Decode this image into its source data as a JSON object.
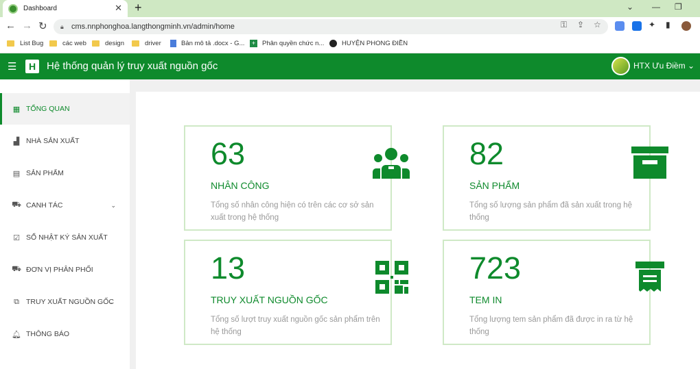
{
  "browser": {
    "tab_title": "Dashboard",
    "tab_close": "✕",
    "new_tab": "+",
    "url": "cms.nnphonghoa.langthongminh.vn/admin/home"
  },
  "bookmarks": [
    {
      "label": "List Bug",
      "icon": "folder-icon"
    },
    {
      "label": "các web",
      "icon": "folder-icon"
    },
    {
      "label": "design",
      "icon": "folder-icon"
    },
    {
      "label": "driver",
      "icon": "folder-icon"
    },
    {
      "label": "Bản mô tả .docx - G...",
      "icon": "doc-icon"
    },
    {
      "label": "Phân quyền chức n...",
      "icon": "sheet-icon"
    },
    {
      "label": "HUYỆN PHONG ĐIỀN",
      "icon": "globe-icon"
    }
  ],
  "header": {
    "logo": "H",
    "title": "Hệ thống quản lý truy xuất nguồn gốc",
    "user": "HTX Ưu Điềm"
  },
  "sidebar": {
    "items": [
      {
        "label": "TỔNG QUAN",
        "icon": "dashboard-icon",
        "active": true
      },
      {
        "label": "NHÀ SẢN XUẤT",
        "icon": "factory-icon"
      },
      {
        "label": "SẢN PHẨM",
        "icon": "store-icon"
      },
      {
        "label": "CANH TÁC",
        "icon": "tractor-icon",
        "has_submenu": true
      },
      {
        "label": "SỔ NHẬT KÝ SẢN XUẤT",
        "icon": "clipboard-icon"
      },
      {
        "label": "ĐƠN VỊ PHÂN PHỐI",
        "icon": "truck-icon"
      },
      {
        "label": "TRUY XUẤT NGUỒN GỐC",
        "icon": "route-icon",
        "has_submenu": true
      },
      {
        "label": "THÔNG BÁO",
        "icon": "bell-icon"
      }
    ]
  },
  "cards": [
    {
      "value": "63",
      "title": "NHÂN CÔNG",
      "desc": "Tổng số nhân công hiện có trên các cơ sở sản xuất trong hệ thống",
      "icon": "users-icon"
    },
    {
      "value": "82",
      "title": "SẢN PHẨM",
      "desc": "Tổng số lượng sản phẩm đã sản xuất trong hệ thống",
      "icon": "archive-box-icon"
    },
    {
      "value": "13",
      "title": "TRUY XUẤT NGUỒN GỐC",
      "desc": "Tổng số lượt truy xuất nguồn gốc sản phẩm trên hệ thống",
      "icon": "qr-code-icon"
    },
    {
      "value": "723",
      "title": "TEM IN",
      "desc": "Tổng lượng tem sản phẩm đã được in ra từ hệ thống",
      "icon": "receipt-print-icon"
    }
  ],
  "colors": {
    "brand": "#0e8a2c",
    "card_border": "#cfe9c6",
    "muted_text": "#999999"
  }
}
